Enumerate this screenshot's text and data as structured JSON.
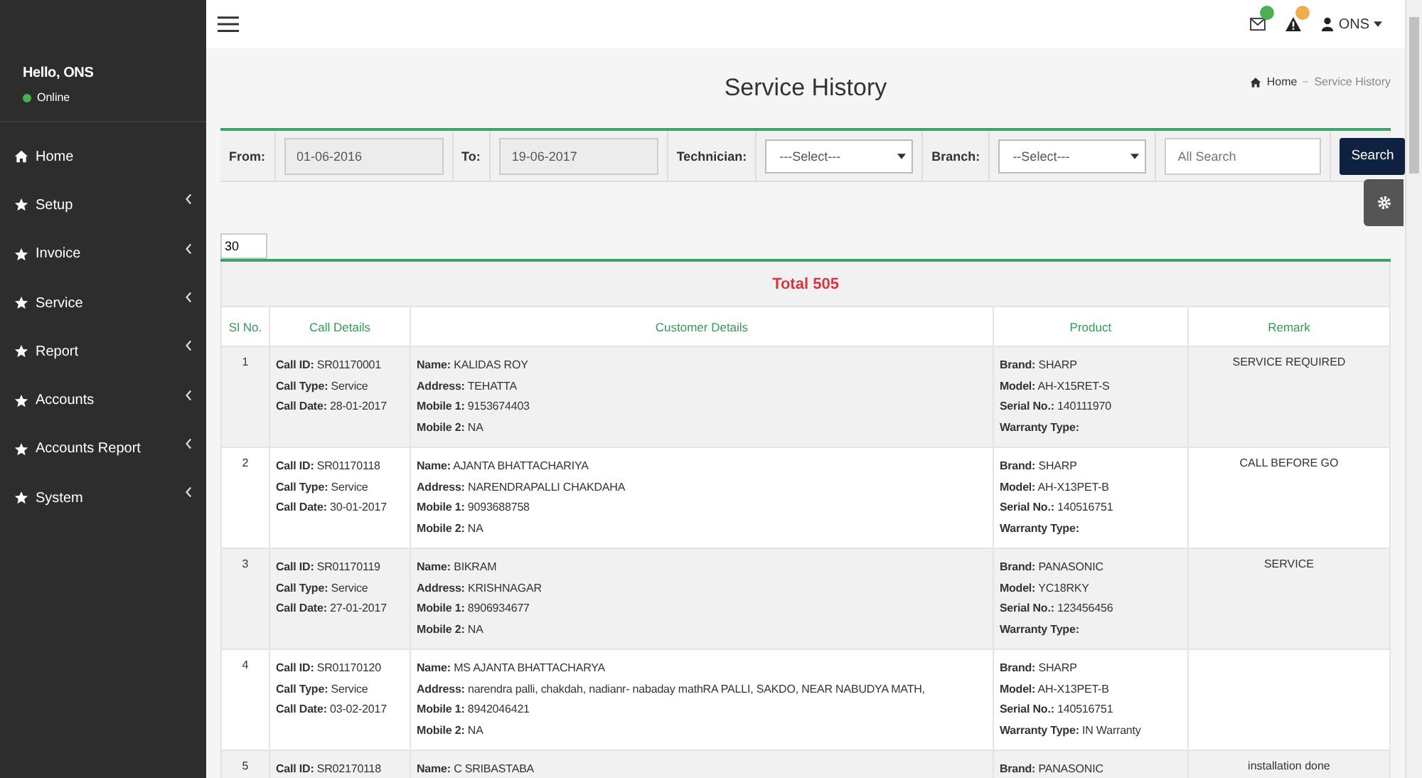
{
  "sidebar": {
    "greeting": "Hello, ONS",
    "status": "Online",
    "items": [
      {
        "label": "Home",
        "kind": "link"
      },
      {
        "label": "Setup",
        "kind": "menu"
      },
      {
        "label": "Invoice",
        "kind": "menu"
      },
      {
        "label": "Service",
        "kind": "menu"
      },
      {
        "label": "Report",
        "kind": "menu"
      },
      {
        "label": "Accounts",
        "kind": "menu"
      },
      {
        "label": "Accounts Report",
        "kind": "menu"
      },
      {
        "label": "System",
        "kind": "menu"
      }
    ]
  },
  "topbar": {
    "notifications": [
      {
        "kind": "mail",
        "color": "#4caf50"
      },
      {
        "kind": "alert",
        "color": "#f0ad4e"
      }
    ],
    "user": "ONS"
  },
  "page": {
    "title": "Service History",
    "breadcrumb": [
      "Home",
      "Service History"
    ]
  },
  "filters": {
    "from": {
      "label": "From:",
      "value": "01-06-2016"
    },
    "to": {
      "label": "To:",
      "value": "19-06-2017"
    },
    "technician": {
      "label": "Technician:",
      "value": "---Select---"
    },
    "branch": {
      "label": "Branch:",
      "value": "--Select---"
    },
    "search": {
      "placeholder": "All Search"
    },
    "button": "Search"
  },
  "page_size": "30",
  "table": {
    "total": "Total 505",
    "columns": [
      "Sl No.",
      "Call Details",
      "Customer Details",
      "Product",
      "Remark"
    ],
    "rows": [
      {
        "sl": "1",
        "call": [
          "**Call ID:** SR01170001",
          "**Call Type:** Service",
          "**Call Date:** 28-01-2017"
        ],
        "customer": [
          "**Name:** KALIDAS ROY",
          "**Address:** TEHATTA",
          "**Mobile 1:** 9153674403",
          "**Mobile 2:** NA"
        ],
        "product": [
          "**Brand:** SHARP",
          "**Model:** AH-X15RET-S",
          "**Serial No.:** 140111970",
          "**Warranty Type:**"
        ],
        "remark": "SERVICE REQUIRED"
      },
      {
        "sl": "2",
        "call": [
          "**Call ID:** SR01170118",
          "**Call Type:** Service",
          "**Call Date:** 30-01-2017"
        ],
        "customer": [
          "**Name:** AJANTA BHATTACHARIYA",
          "**Address:** NARENDRAPALLI CHAKDAHA",
          "**Mobile 1:** 9093688758",
          "**Mobile 2:** NA"
        ],
        "product": [
          "**Brand:** SHARP",
          "**Model:** AH-X13PET-B",
          "**Serial No.:** 140516751",
          "**Warranty Type:**"
        ],
        "remark": "CALL BEFORE GO"
      },
      {
        "sl": "3",
        "call": [
          "**Call ID:** SR01170119",
          "**Call Type:** Service",
          "**Call Date:** 27-01-2017"
        ],
        "customer": [
          "**Name:** BIKRAM",
          "**Address:** KRISHNAGAR",
          "**Mobile 1:** 8906934677",
          "**Mobile 2:** NA"
        ],
        "product": [
          "**Brand:** PANASONIC",
          "**Model:** YC18RKY",
          "**Serial No.:** 123456456",
          "**Warranty Type:**"
        ],
        "remark": "SERVICE"
      },
      {
        "sl": "4",
        "call": [
          "**Call ID:** SR01170120",
          "**Call Type:** Service",
          "**Call Date:** 03-02-2017"
        ],
        "customer": [
          "**Name:** MS AJANTA BHATTACHARYA",
          "**Address:** narendra palli, chakdah, nadianr- nabaday mathRA PALLI, SAKDO, NEAR NABUDYA MATH,",
          "**Mobile 1:** 8942046421",
          "**Mobile 2:** NA"
        ],
        "product": [
          "**Brand:** SHARP",
          "**Model:** AH-X13PET-B",
          "**Serial No.:** 140516751",
          "**Warranty Type:** IN Warranty"
        ]
      },
      {
        "sl": "5",
        "call": [
          "**Call ID:** SR02170118"
        ],
        "customer": [
          "**Name:** C SRIBASTABA"
        ],
        "product": [
          "**Brand:** PANASONIC"
        ],
        "remark": "installation done"
      }
    ]
  }
}
